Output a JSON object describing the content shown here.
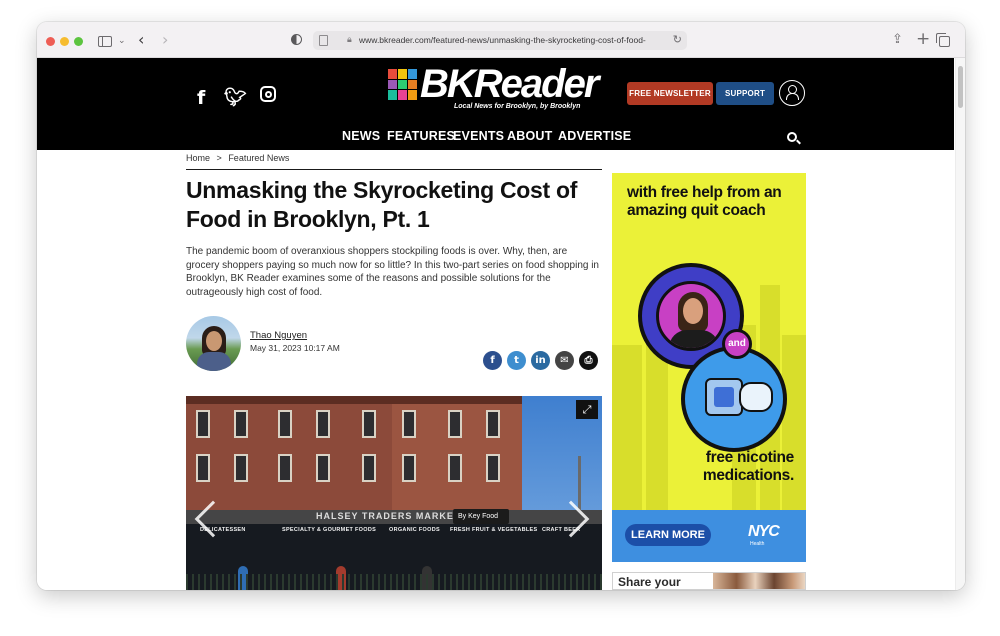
{
  "browser": {
    "url": "www.bkreader.com/featured-news/unmasking-the-skyrocketing-cost-of-food-"
  },
  "header": {
    "logo_text": "BKReader",
    "tagline": "Local News for Brooklyn, by Brooklyn",
    "newsletter_label": "FREE NEWSLETTER",
    "support_label": "SUPPORT",
    "logo_colors": [
      "#e74c3c",
      "#f1c40f",
      "#3498db",
      "#9b59b6",
      "#2ecc71",
      "#e67e22",
      "#1abc9c",
      "#e84393",
      "#f39c12"
    ]
  },
  "nav": {
    "items": [
      {
        "label": "NEWS"
      },
      {
        "label": "FEATURES"
      },
      {
        "label": "EVENTS"
      },
      {
        "label": "ABOUT"
      },
      {
        "label": "ADVERTISE"
      }
    ]
  },
  "article": {
    "breadcrumb_home": "Home",
    "breadcrumb_sep": ">",
    "breadcrumb_section": "Featured News",
    "title": "Unmasking the Skyrocketing Cost of Food in Brooklyn, Pt. 1",
    "dek": "The pandemic boom of overanxious shoppers stockpiling foods is over. Why, then, are grocery shoppers paying so much now for so little? In this two-part series on food shopping in Brooklyn, BK Reader examines some of the reasons and possible solutions for the outrageously high cost of food.",
    "author": "Thao Nguyen",
    "date": "May 31, 2023 10:17 AM"
  },
  "hero": {
    "market_sign": "HALSEY TRADERS MARKET",
    "by_sign": "By Key Food",
    "store_signs": [
      "DELICATESSEN",
      "SPECIALTY & GOURMET FOODS",
      "ORGANIC FOODS",
      "FRESH FRUIT & VEGETABLES",
      "CRAFT BEER"
    ]
  },
  "ad": {
    "headline": "with free help from an amazing quit coach",
    "and_label": "and",
    "sub": "free nicotine medications.",
    "cta": "LEARN MORE",
    "brand": "NYC",
    "brand_sub": "Health"
  },
  "ad2": {
    "text": "Share your message here"
  }
}
